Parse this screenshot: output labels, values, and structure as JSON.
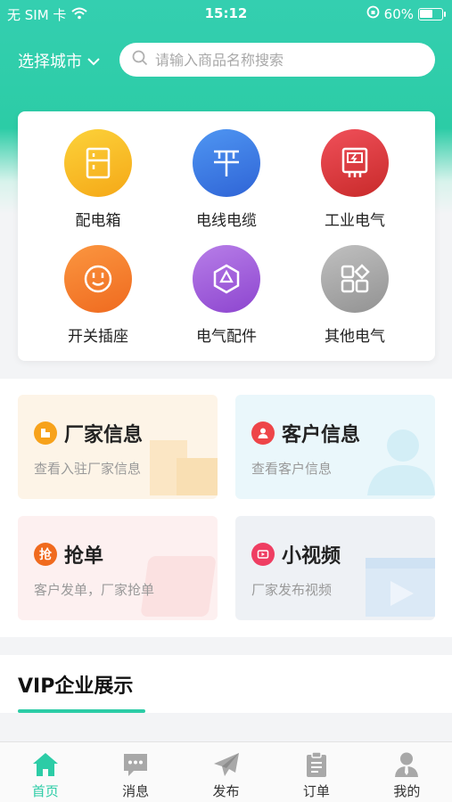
{
  "status_bar": {
    "carrier": "无 SIM 卡",
    "time": "15:12",
    "battery_percent": "60%",
    "battery_level": 0.6
  },
  "header": {
    "city_label": "选择城市",
    "search_placeholder": "请输入商品名称搜索"
  },
  "categories": [
    {
      "label": "配电箱",
      "icon": "cabinet-icon",
      "color": "#f7b81d"
    },
    {
      "label": "电线电缆",
      "icon": "cable-icon",
      "color": "#3a7ee6"
    },
    {
      "label": "工业电气",
      "icon": "electric-meter-icon",
      "color": "#e23e3e"
    },
    {
      "label": "开关插座",
      "icon": "socket-icon",
      "color": "#f57c2a"
    },
    {
      "label": "电气配件",
      "icon": "hexagon-icon",
      "color": "#a35ed9"
    },
    {
      "label": "其他电气",
      "icon": "grid-icon",
      "color": "#a8a8a8"
    }
  ],
  "services": [
    {
      "title": "厂家信息",
      "subtitle": "查看入驻厂家信息",
      "icon": "factory-icon"
    },
    {
      "title": "客户信息",
      "subtitle": "查看客户信息",
      "icon": "user-icon"
    },
    {
      "title": "抢单",
      "subtitle": "客户发单，厂家抢单",
      "icon": "grab-order-icon",
      "icon_text": "抢"
    },
    {
      "title": "小视频",
      "subtitle": "厂家发布视频",
      "icon": "video-icon"
    }
  ],
  "vip": {
    "title": "VIP企业展示"
  },
  "tabs": [
    {
      "label": "首页",
      "icon": "home-icon",
      "active": true
    },
    {
      "label": "消息",
      "icon": "message-icon",
      "active": false
    },
    {
      "label": "发布",
      "icon": "send-icon",
      "active": false
    },
    {
      "label": "订单",
      "icon": "order-icon",
      "active": false
    },
    {
      "label": "我的",
      "icon": "profile-icon",
      "active": false
    }
  ],
  "colors": {
    "brand": "#2ccca6",
    "text_primary": "#222222",
    "text_secondary": "#999999"
  }
}
